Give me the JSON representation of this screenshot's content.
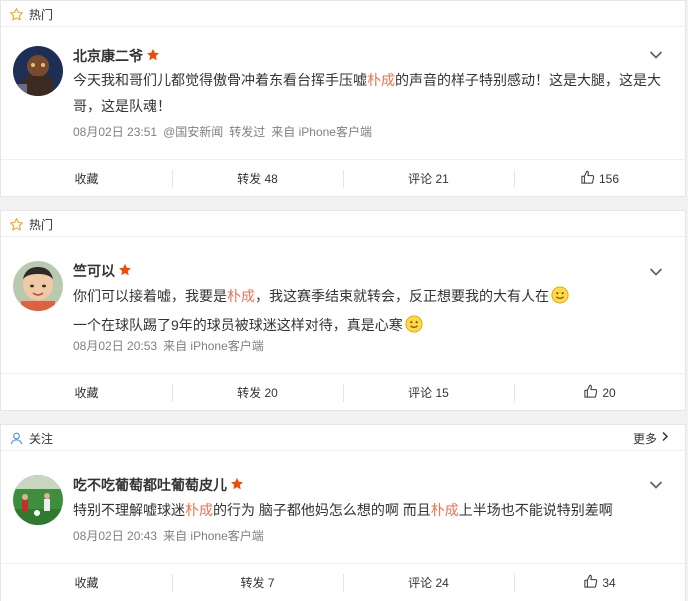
{
  "posts": [
    {
      "tag": "热门",
      "username": "北京康二爷",
      "text": [
        {
          "t": "今天我和哥们儿都觉得傲骨冲着东看台挥手压嘘"
        },
        {
          "t": "朴成",
          "hl": true
        },
        {
          "t": "的声音的样子特别感动！这是大腿，这是大哥，这是队魂！"
        }
      ],
      "meta": {
        "time": "08月02日 23:51",
        "via_user": "@国安新闻",
        "repost_label": "转发过",
        "source": "来自 iPhone客户端"
      },
      "actions": {
        "favorite": "收藏",
        "repost": "转发 48",
        "comment": "评论 21",
        "like": "156"
      }
    },
    {
      "tag": "热门",
      "username": "竺可以",
      "text_lines": [
        [
          {
            "t": "你们可以接着嘘，我要是"
          },
          {
            "t": "朴成",
            "hl": true
          },
          {
            "t": "，我这赛季结束就转会，反正想要我的大有人在"
          },
          {
            "emoji": "smile"
          }
        ],
        [
          {
            "t": "一个在球队踢了9年的球员被球迷这样对待，真是心寒"
          },
          {
            "emoji": "smile"
          }
        ]
      ],
      "meta": {
        "time": "08月02日 20:53",
        "source": "来自 iPhone客户端"
      },
      "actions": {
        "favorite": "收藏",
        "repost": "转发 20",
        "comment": "评论 15",
        "like": "20"
      }
    },
    {
      "tag": "关注",
      "more": "更多",
      "username": "吃不吃葡萄都吐葡萄皮儿",
      "text": [
        {
          "t": "特别不理解嘘球迷"
        },
        {
          "t": "朴成",
          "hl": true
        },
        {
          "t": "的行为 脑子都他妈怎么想的啊 而且"
        },
        {
          "t": "朴成",
          "hl": true
        },
        {
          "t": "上半场也不能说特别差啊"
        }
      ],
      "meta": {
        "time": "08月02日 20:43",
        "source": "来自 iPhone客户端"
      },
      "actions": {
        "favorite": "收藏",
        "repost": "转发 7",
        "comment": "评论 24",
        "like": "34"
      }
    }
  ],
  "icons": {
    "hot": "star-outline-icon",
    "follow": "person-outline-icon",
    "verified": "red-star-icon",
    "menu": "chevron-down-icon",
    "like": "thumbs-up-icon",
    "emoji": "smile-emoji-icon"
  },
  "colors": {
    "highlight": "#eb7350",
    "verified": "#f04b00",
    "tag_icon": "#f5a623",
    "follow_icon": "#4a90e2"
  }
}
